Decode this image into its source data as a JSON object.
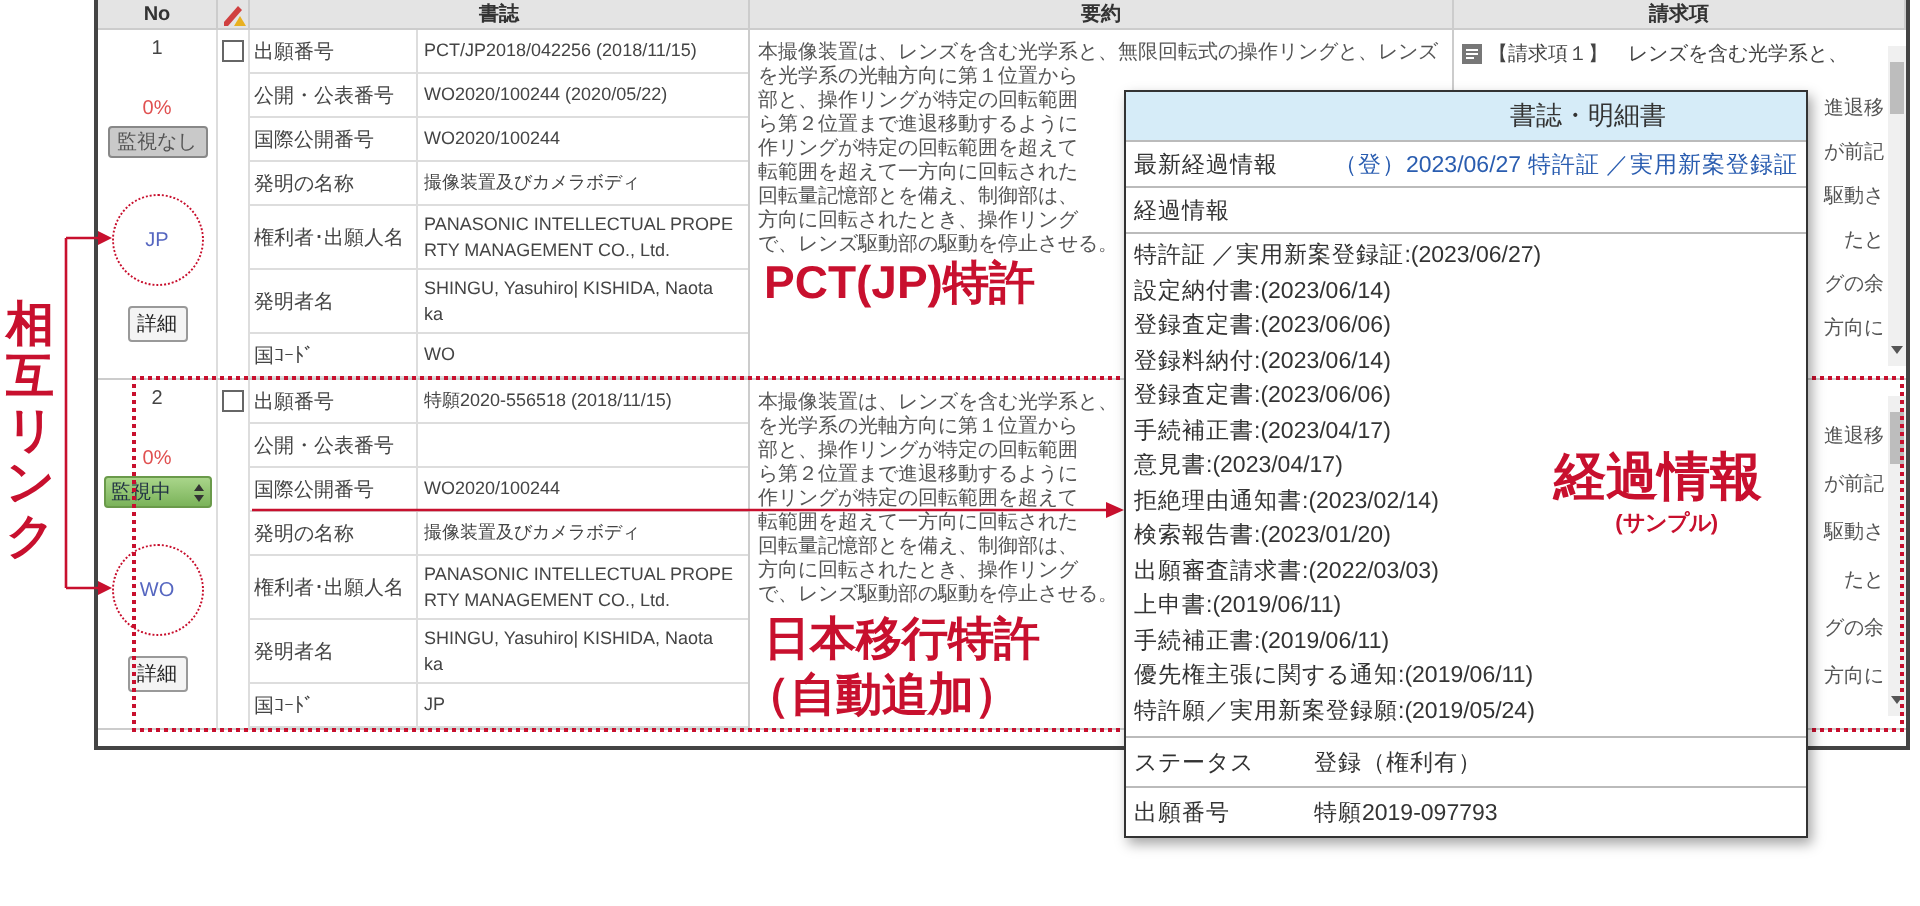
{
  "columns": {
    "no": "No",
    "bib": "書誌",
    "abstract": "要約",
    "claims": "請求項"
  },
  "rows": [
    {
      "no": "1",
      "checked": false,
      "progress": "0%",
      "monitor": {
        "kind": "button",
        "label": "監視なし"
      },
      "country_link": "JP",
      "detail_button": "詳細",
      "fields": [
        {
          "label": "出願番号",
          "lines": [
            "PCT/JP2018/042256 (2018/11/15)"
          ]
        },
        {
          "label": "公開・公表番号",
          "lines": [
            "WO2020/100244 (2020/05/22)"
          ]
        },
        {
          "label": "国際公開番号",
          "lines": [
            "WO2020/100244"
          ]
        },
        {
          "label": "発明の名称",
          "lines": [
            "撮像装置及びカメラボディ"
          ]
        },
        {
          "label": "権利者･出願人名",
          "lines": [
            "PANASONIC INTELLECTUAL PROPE",
            "RTY MANAGEMENT CO.,  Ltd."
          ]
        },
        {
          "label": "発明者名",
          "lines": [
            "SHINGU, Yasuhiro| KISHIDA, Naota",
            "ka"
          ]
        },
        {
          "label": "国ｺｰﾄﾞ",
          "lines": [
            "WO"
          ]
        }
      ],
      "abstract": [
        "本撮像装置は、レンズを含む光学系と、無限回転式の操作リングと、レンズ",
        "を光学系の光軸方向に第１位置から",
        "部と、操作リングが特定の回転範囲",
        "ら第２位置まで進退移動するように",
        "作リングが特定の回転範囲を超えて",
        "転範囲を超えて一方向に回転された",
        "回転量記憶部とを備え、制御部は、",
        "方向に回転されたとき、操作リング",
        "で、レンズ駆動部の駆動を停止させる。"
      ],
      "claims_heading": "【請求項１】　レンズを含む光学系と、",
      "claims_fragments": [
        "進退移",
        "が前記",
        "駆動さ",
        "たと",
        "グの余",
        "方向に"
      ]
    },
    {
      "no": "2",
      "checked": false,
      "progress": "0%",
      "monitor": {
        "kind": "select",
        "label": "監視中"
      },
      "country_link": "WO",
      "detail_button": "詳細",
      "fields": [
        {
          "label": "出願番号",
          "lines": [
            "特願2020-556518 (2018/11/15)"
          ]
        },
        {
          "label": "公開・公表番号"
        },
        {
          "label": "国際公開番号",
          "lines": [
            "WO2020/100244"
          ]
        },
        {
          "label": "発明の名称",
          "lines": [
            "撮像装置及びカメラボディ"
          ]
        },
        {
          "label": "権利者･出願人名",
          "lines": [
            "PANASONIC INTELLECTUAL PROPE",
            "RTY MANAGEMENT CO.,  Ltd."
          ]
        },
        {
          "label": "発明者名",
          "lines": [
            "SHINGU, Yasuhiro| KISHIDA, Naota",
            "ka"
          ]
        },
        {
          "label": "国ｺｰﾄﾞ",
          "lines": [
            "JP"
          ]
        }
      ],
      "abstract": [
        "本撮像装置は、レンズを含む光学系と、",
        "を光学系の光軸方向に第１位置から",
        "部と、操作リングが特定の回転範囲",
        "ら第２位置まで進退移動するように",
        "作リングが特定の回転範囲を超えて",
        "転範囲を超えて一方向に回転された",
        "回転量記憶部とを備え、制御部は、",
        "方向に回転されたとき、操作リング",
        "で、レンズ駆動部の駆動を停止させる。"
      ],
      "claims_fragments": [
        "進退移",
        "が前記",
        "駆動さ",
        "たと",
        "グの余",
        "方向に"
      ]
    }
  ],
  "popup": {
    "title": "書誌・明細書",
    "latest_label": "最新経過情報",
    "latest_value": "（登）2023/06/27 特許証 ／実用新案登録証",
    "history_label": "経過情報",
    "history": [
      "特許証 ／実用新案登録証:(2023/06/27)",
      "設定納付書:(2023/06/14)",
      "登録査定書:(2023/06/06)",
      "登録料納付:(2023/06/14)",
      "登録査定書:(2023/06/06)",
      "手続補正書:(2023/04/17)",
      "意見書:(2023/04/17)",
      "拒絶理由通知書:(2023/02/14)",
      "検索報告書:(2023/01/20)",
      "出願審査請求書:(2022/03/03)",
      "上申書:(2019/06/11)",
      "手続補正書:(2019/06/11)",
      "優先権主張に関する通知:(2019/06/11)",
      "特許願／実用新案登録願:(2019/05/24)"
    ],
    "details": [
      {
        "label": "ステータス",
        "value": "登録（権利有）"
      },
      {
        "label": "出願番号",
        "value": "特願2019-097793"
      }
    ]
  },
  "annotations": {
    "pct": "PCT(JP)特許",
    "jp_entry": [
      "日本移行特許",
      "（自動追加）"
    ],
    "history": "経過情報",
    "history_note": "(サンプル)",
    "mutual_link": "相互リンク"
  }
}
